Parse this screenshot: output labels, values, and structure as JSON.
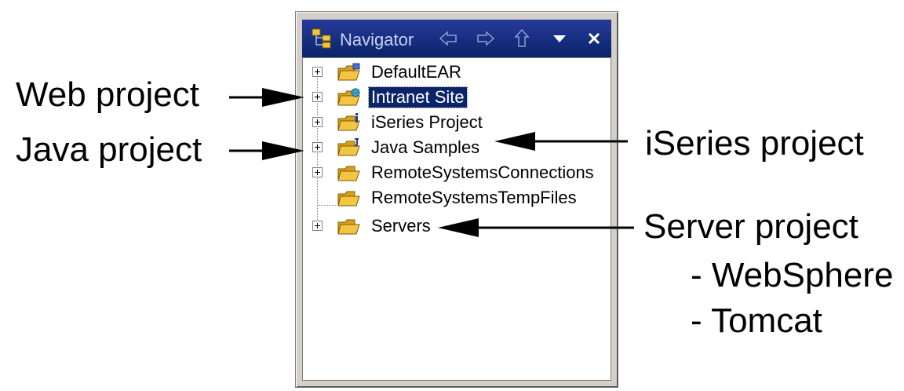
{
  "navigator": {
    "title": "Navigator",
    "toolbar": [
      {
        "name": "back-icon",
        "enabled": false
      },
      {
        "name": "forward-icon",
        "enabled": false
      },
      {
        "name": "up-icon",
        "enabled": false
      },
      {
        "name": "view-menu-icon",
        "enabled": true
      },
      {
        "name": "close-icon",
        "enabled": true
      }
    ],
    "items": [
      {
        "label": "DefaultEAR",
        "expandable": true,
        "icon": "ear-project-icon",
        "selected": false
      },
      {
        "label": "Intranet Site",
        "expandable": true,
        "icon": "web-project-icon",
        "selected": true
      },
      {
        "label": "iSeries Project",
        "expandable": true,
        "icon": "iseries-project-icon",
        "selected": false
      },
      {
        "label": "Java Samples",
        "expandable": true,
        "icon": "java-project-icon",
        "selected": false
      },
      {
        "label": "RemoteSystemsConnections",
        "expandable": true,
        "icon": "folder-icon",
        "selected": false
      },
      {
        "label": "RemoteSystemsTempFiles",
        "expandable": false,
        "icon": "folder-icon",
        "selected": false
      },
      {
        "label": "Servers",
        "expandable": true,
        "icon": "server-project-icon",
        "selected": false
      }
    ]
  },
  "annotations": {
    "web_project": "Web project",
    "java_project": "Java project",
    "iseries_project": "iSeries project",
    "server_project": "Server project",
    "websphere": "- WebSphere",
    "tomcat": "- Tomcat"
  },
  "colors": {
    "title_bar": "#0a246a",
    "selection": "#0a246a",
    "folder": "#f4c542"
  }
}
